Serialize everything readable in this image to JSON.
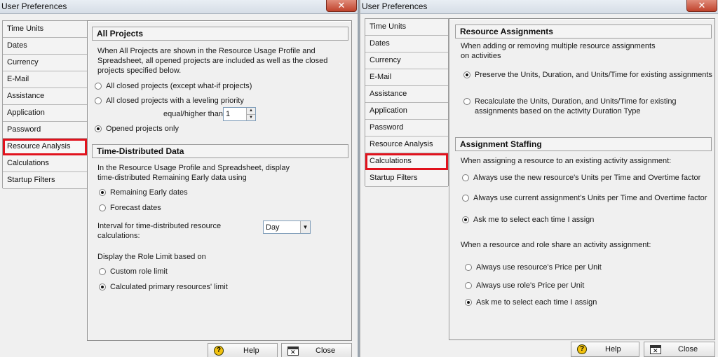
{
  "left_window": {
    "title": "User Preferences",
    "close_glyph": "✕",
    "nav_items": [
      "Time Units",
      "Dates",
      "Currency",
      "E-Mail",
      "Assistance",
      "Application",
      "Password",
      "Resource Analysis",
      "Calculations",
      "Startup Filters"
    ],
    "selected_item": "Resource Analysis",
    "all_projects": {
      "title": "All Projects",
      "description": "When All Projects are shown in the Resource Usage Profile and Spreadsheet, all opened projects are included as well as the closed projects specified below.",
      "options": [
        "All closed projects (except what-if projects)",
        "All closed projects with a leveling priority",
        "Opened projects only"
      ],
      "selected_option": "Opened projects only",
      "priority_label": "equal/higher than",
      "priority_value": "1"
    },
    "time_distributed": {
      "title": "Time-Distributed Data",
      "description": "In the Resource Usage Profile and Spreadsheet, display time-distributed Remaining Early data using",
      "options": [
        "Remaining Early dates",
        "Forecast dates"
      ],
      "selected_option": "Remaining Early dates",
      "interval_label": "Interval for time-distributed resource calculations:",
      "interval_value": "Day",
      "role_limit_label": "Display the Role Limit based on",
      "role_options": [
        "Custom role limit",
        "Calculated primary resources' limit"
      ],
      "selected_role_option": "Calculated primary resources' limit"
    },
    "help_label": "Help",
    "close_label": "Close"
  },
  "right_window": {
    "title": "User Preferences",
    "close_glyph": "✕",
    "nav_items": [
      "Time Units",
      "Dates",
      "Currency",
      "E-Mail",
      "Assistance",
      "Application",
      "Password",
      "Resource Analysis",
      "Calculations",
      "Startup Filters"
    ],
    "selected_item": "Calculations",
    "resource_assignments": {
      "title": "Resource Assignments",
      "description": "When adding or removing multiple resource assignments on activities",
      "options": [
        "Preserve the Units, Duration, and Units/Time for existing assignments",
        "Recalculate the Units, Duration, and Units/Time for existing assignments based on the activity Duration Type"
      ],
      "selected_option": "Preserve the Units, Duration, and Units/Time for existing assignments"
    },
    "assignment_staffing": {
      "title": "Assignment Staffing",
      "prompt1": "When assigning a resource to an existing activity assignment:",
      "options1": [
        "Always use the new resource's Units per Time and Overtime factor",
        "Always use current assignment's Units per Time and Overtime factor",
        "Ask me to select each time I assign"
      ],
      "selected1": "Ask me to select each time I assign",
      "prompt2": "When a resource and role share an activity assignment:",
      "options2": [
        "Always use resource's Price per Unit",
        "Always use role's Price per Unit",
        "Ask me to select each time I assign"
      ],
      "selected2": "Ask me to select each time I assign"
    },
    "help_label": "Help",
    "close_label": "Close"
  },
  "colors": {
    "highlight": "#e1121d",
    "window_bg": "#f0f0f0",
    "close_button": "#c0432c"
  }
}
